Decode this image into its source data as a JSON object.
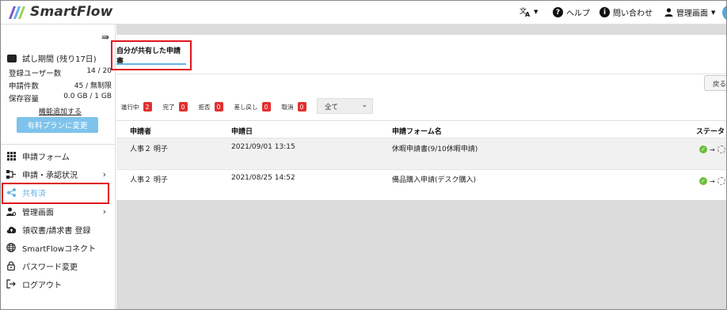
{
  "app": {
    "name": "SmartFlow",
    "brand_colors": [
      "#7a57c7",
      "#5bb0e8",
      "#9dd44a"
    ],
    "accent_color": "#64b4e6"
  },
  "header": {
    "translate_label": "",
    "help_label": "ヘルプ",
    "contact_label": "問い合わせ",
    "admin_label": "管理画面"
  },
  "sidebar": {
    "trial_label": "試し期間 (残り17日)",
    "stats": [
      {
        "label": "登録ユーザー数",
        "value": "14 / 20"
      },
      {
        "label": "申請件数",
        "value": "45 / 無制限"
      },
      {
        "label": "保存容量",
        "value": "0.0 GB / 1 GB"
      }
    ],
    "add_feature_label": "機能追加する",
    "upgrade_label": "有料プランに変更",
    "items": [
      {
        "label": "申請フォーム",
        "icon": "grid-icon",
        "chevron": false
      },
      {
        "label": "申請・承認状況",
        "icon": "flow-icon",
        "chevron": true
      },
      {
        "label": "共有済",
        "icon": "share-icon",
        "chevron": false,
        "active": true
      },
      {
        "label": "管理画面",
        "icon": "user-gear-icon",
        "chevron": true
      },
      {
        "label": "領収書/請求書 登録",
        "icon": "cloud-upload-icon",
        "chevron": false
      },
      {
        "label": "SmartFlowコネクト",
        "icon": "globe-icon",
        "chevron": false
      },
      {
        "label": "パスワード変更",
        "icon": "lock-icon",
        "chevron": false
      },
      {
        "label": "ログアウト",
        "icon": "logout-icon",
        "chevron": false
      }
    ]
  },
  "main": {
    "tab_label": "自分が共有した申請書",
    "back_label": "戻る",
    "filters": [
      {
        "label": "進行中",
        "count": "2"
      },
      {
        "label": "完了",
        "count": "0"
      },
      {
        "label": "拒否",
        "count": "0"
      },
      {
        "label": "差し戻し",
        "count": "0"
      },
      {
        "label": "取消",
        "count": "0"
      }
    ],
    "select_value": "全て",
    "columns": [
      "申請者",
      "申請日",
      "申請フォーム名",
      "ステータス"
    ],
    "rows": [
      {
        "applicant": "人事２ 明子",
        "date": "2021/09/01 13:15",
        "form": "休暇申請書(9/10休暇申請)",
        "status": "approved-then-pending"
      },
      {
        "applicant": "人事２ 明子",
        "date": "2021/08/25 14:52",
        "form": "備品購入申請(デスク購入)",
        "status": "approved-then-pending"
      }
    ]
  },
  "highlight_color": "#e0161c"
}
